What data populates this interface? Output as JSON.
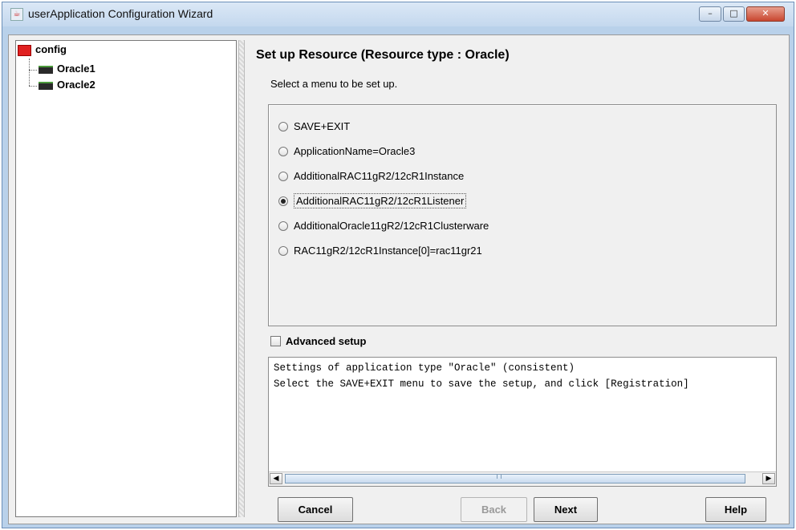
{
  "window": {
    "title": "userApplication Configuration Wizard",
    "buttons": {
      "minimize": "–",
      "maximize": "□",
      "close": "✕"
    }
  },
  "tree": {
    "root": {
      "label": "config",
      "icon": "config-icon"
    },
    "children": [
      {
        "label": "Oracle1",
        "icon": "resource-icon"
      },
      {
        "label": "Oracle2",
        "icon": "resource-icon"
      }
    ]
  },
  "main": {
    "heading": "Set up Resource (Resource type : Oracle)",
    "subtitle": "Select a menu to be set up.",
    "menu_options": [
      {
        "label": "SAVE+EXIT",
        "selected": false
      },
      {
        "label": "ApplicationName=Oracle3",
        "selected": false
      },
      {
        "label": "AdditionalRAC11gR2/12cR1Instance",
        "selected": false
      },
      {
        "label": "AdditionalRAC11gR2/12cR1Listener",
        "selected": true
      },
      {
        "label": "AdditionalOracle11gR2/12cR1Clusterware",
        "selected": false
      },
      {
        "label": "RAC11gR2/12cR1Instance[0]=rac11gr21",
        "selected": false
      }
    ],
    "advanced_setup": {
      "label": "Advanced setup",
      "checked": false
    },
    "log_lines": [
      "Settings of application type \"Oracle\" (consistent)",
      "Select the SAVE+EXIT menu to save the setup, and click [Registration]"
    ]
  },
  "buttons": {
    "cancel": "Cancel",
    "back": "Back",
    "next": "Next",
    "help": "Help"
  },
  "colors": {
    "title_bar": "#c4d8ee",
    "close_button": "#c8462f",
    "config_icon": "#e02020"
  }
}
